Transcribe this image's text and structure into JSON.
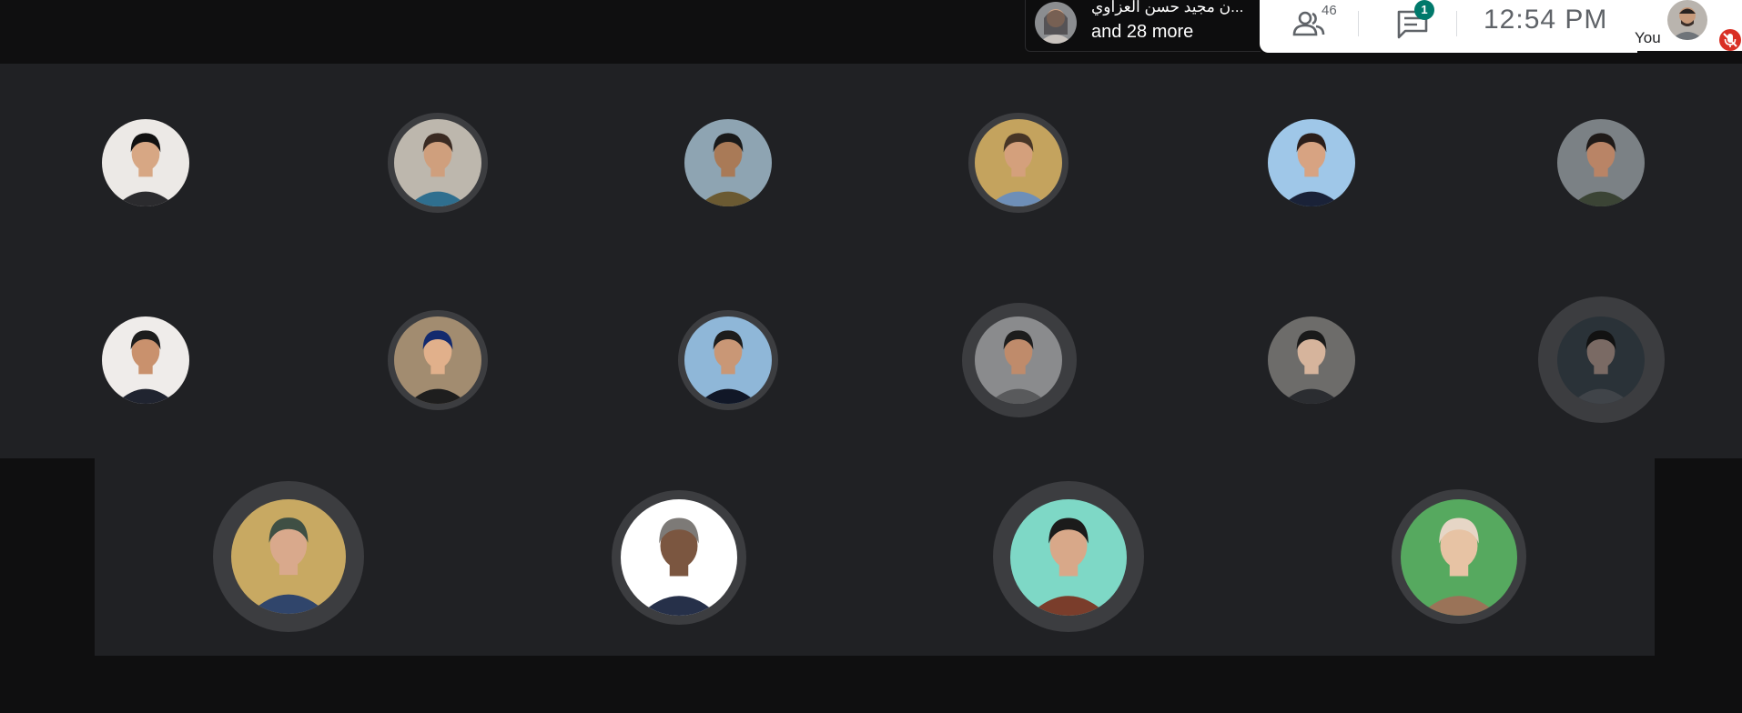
{
  "topbar": {
    "presenter_name": "...ن مجيد حسن العزاوي",
    "presenter_more": "and 28 more",
    "people_count": "46",
    "chat_badge": "1",
    "time": "12:54  PM",
    "self_label": "You",
    "icons": [
      "people-icon",
      "chat-icon",
      "mic-off-icon"
    ]
  },
  "participants": [
    {
      "name": "participant-1",
      "colors": {
        "bg": "#ece9e6",
        "skin": "#d7a784",
        "hair": "#111111",
        "shirt": "#2b2b2e"
      }
    },
    {
      "name": "participant-2",
      "colors": {
        "bg": "#bdb7ad",
        "skin": "#cf9f7d",
        "hair": "#3a2a22",
        "shirt": "#2f6f8f"
      }
    },
    {
      "name": "participant-3",
      "colors": {
        "bg": "#8ea4b2",
        "skin": "#a97a57",
        "hair": "#191919",
        "shirt": "#6b5a32"
      }
    },
    {
      "name": "participant-4",
      "colors": {
        "bg": "#c4a35e",
        "skin": "#d4a07c",
        "hair": "#473526",
        "shirt": "#6e8fb8"
      }
    },
    {
      "name": "participant-5",
      "colors": {
        "bg": "#9fc7e8",
        "skin": "#d7a382",
        "hair": "#2b1e1a",
        "shirt": "#1a2238"
      }
    },
    {
      "name": "participant-6",
      "colors": {
        "bg": "#7b8185",
        "skin": "#b98466",
        "hair": "#1f1a18",
        "shirt": "#3b4435"
      }
    },
    {
      "name": "participant-7",
      "colors": {
        "bg": "#efecea",
        "skin": "#c9916d",
        "hair": "#1d1d1d",
        "shirt": "#202430"
      }
    },
    {
      "name": "participant-8",
      "colors": {
        "bg": "#a28c70",
        "skin": "#e1b08b",
        "hair": "#132a6e",
        "shirt": "#1e1e1e"
      }
    },
    {
      "name": "participant-9",
      "colors": {
        "bg": "#8fb7d8",
        "skin": "#c99776",
        "hair": "#1d1d1d",
        "shirt": "#111727"
      }
    },
    {
      "name": "participant-10",
      "colors": {
        "bg": "#8a8b8d",
        "skin": "#bf8b6b",
        "hair": "#1d1d1d",
        "shirt": "#595a5c"
      }
    },
    {
      "name": "participant-11",
      "colors": {
        "bg": "#6d6c6a",
        "skin": "#d6b49c",
        "hair": "#1a1a1a",
        "shirt": "#2b2d31"
      }
    },
    {
      "name": "participant-12",
      "colors": {
        "bg": "#2a3238",
        "skin": "#7a6a64",
        "hair": "#121212",
        "shirt": "#404449"
      }
    },
    {
      "name": "participant-13",
      "colors": {
        "bg": "#c8a962",
        "skin": "#d9a98c",
        "hair": "#3f4f44",
        "shirt": "#30456b"
      }
    },
    {
      "name": "participant-14",
      "colors": {
        "bg": "#ffffff",
        "skin": "#7b5640",
        "hair": "#7d7a77",
        "shirt": "#263049"
      }
    },
    {
      "name": "participant-15",
      "colors": {
        "bg": "#7ed8c6",
        "skin": "#d8a889",
        "hair": "#1b1b1b",
        "shirt": "#7a3d2b"
      }
    },
    {
      "name": "participant-16",
      "colors": {
        "bg": "#56a95f",
        "skin": "#e7c3a4",
        "hair": "#e6d6c6",
        "shirt": "#9a7358"
      }
    }
  ],
  "accent_colors": {
    "chat_badge": "#00796b",
    "mic_off": "#d93025"
  }
}
